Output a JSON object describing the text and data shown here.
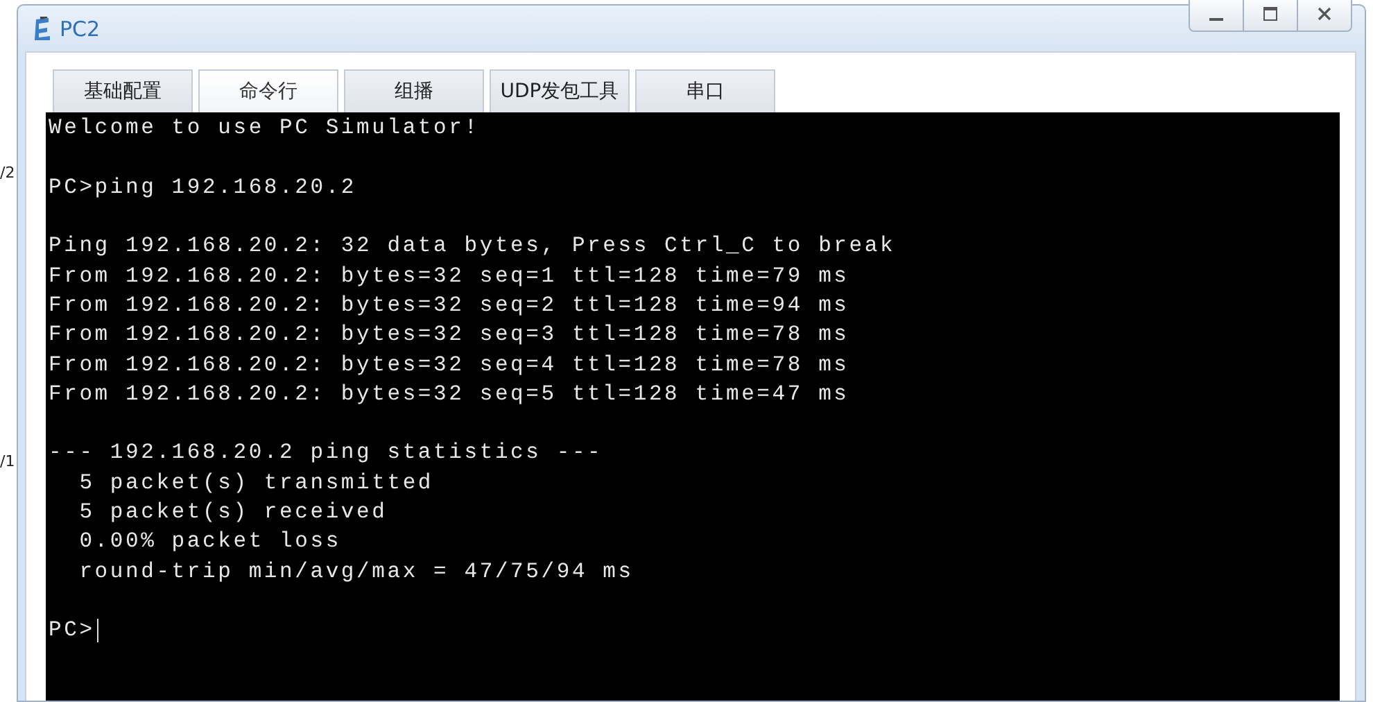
{
  "background_labels": [
    "/2",
    "/1"
  ],
  "window": {
    "title": "PC2"
  },
  "tabs": [
    {
      "label": "基础配置",
      "selected": false
    },
    {
      "label": "命令行",
      "selected": true
    },
    {
      "label": "组播",
      "selected": false
    },
    {
      "label": "UDP发包工具",
      "selected": false
    },
    {
      "label": "串口",
      "selected": false
    }
  ],
  "terminal": {
    "blocks": [
      {
        "lines": [
          "Welcome to use PC Simulator!"
        ]
      },
      {
        "lines": [
          "PC>ping 192.168.20.2"
        ]
      },
      {
        "lines": [
          "Ping 192.168.20.2: 32 data bytes, Press Ctrl_C to break",
          "From 192.168.20.2: bytes=32 seq=1 ttl=128 time=79 ms",
          "From 192.168.20.2: bytes=32 seq=2 ttl=128 time=94 ms",
          "From 192.168.20.2: bytes=32 seq=3 ttl=128 time=78 ms",
          "From 192.168.20.2: bytes=32 seq=4 ttl=128 time=78 ms",
          "From 192.168.20.2: bytes=32 seq=5 ttl=128 time=47 ms"
        ]
      },
      {
        "lines": [
          "--- 192.168.20.2 ping statistics ---",
          "  5 packet(s) transmitted",
          "  5 packet(s) received",
          "  0.00% packet loss",
          "  round-trip min/avg/max = 47/75/94 ms"
        ]
      }
    ],
    "prompt": "PC>"
  }
}
